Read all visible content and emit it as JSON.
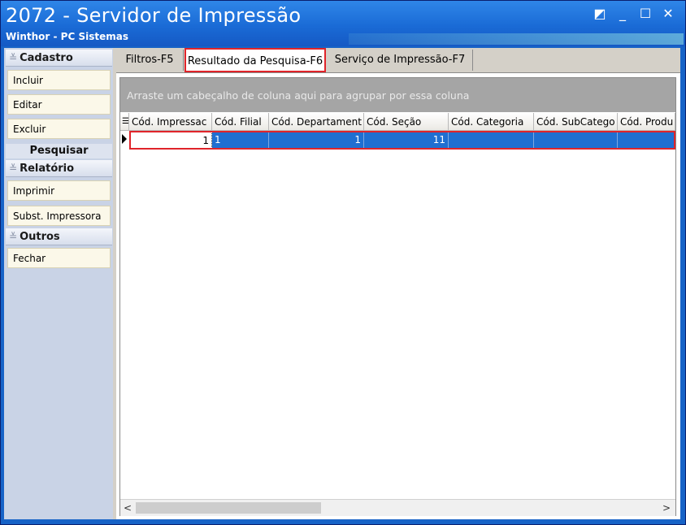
{
  "window": {
    "title": "2072 - Servidor de Impressão",
    "subtitle": "Winthor - PC Sistemas",
    "controls": {
      "restore": "◩",
      "minimize": "_",
      "maximize": "☐",
      "close": "✕"
    }
  },
  "sidebar": {
    "cadastro": {
      "title": "Cadastro",
      "items": [
        "Incluir",
        "Editar",
        "Excluir"
      ]
    },
    "pesquisar": "Pesquisar",
    "relatorio": {
      "title": "Relatório",
      "items": [
        "Imprimir",
        "Subst. Impressora"
      ]
    },
    "outros": {
      "title": "Outros",
      "items": [
        "Fechar"
      ]
    },
    "chevron": "≚"
  },
  "tabs": [
    {
      "label": "Filtros-F5"
    },
    {
      "label": "Resultado da Pesquisa-F6",
      "active": true
    },
    {
      "label": "Serviço de Impressão-F7"
    }
  ],
  "grid": {
    "group_hint": "Arraste um cabeçalho de coluna aqui para agrupar por essa coluna",
    "columns": [
      "Cód. Impressac",
      "Cód. Filial",
      "Cód. Departament",
      "Cód. Seção",
      "Cód. Categoria",
      "Cód. SubCatego",
      "Cód. Produ"
    ],
    "rows": [
      [
        "1",
        "1",
        "1",
        "11",
        "",
        "",
        ""
      ]
    ]
  },
  "scrollbar": {
    "left_arrow": "<",
    "right_arrow": ">"
  },
  "colors": {
    "title_bar": "#1a6bd6",
    "selection": "#1f6fd1",
    "highlight": "#e0242a"
  }
}
